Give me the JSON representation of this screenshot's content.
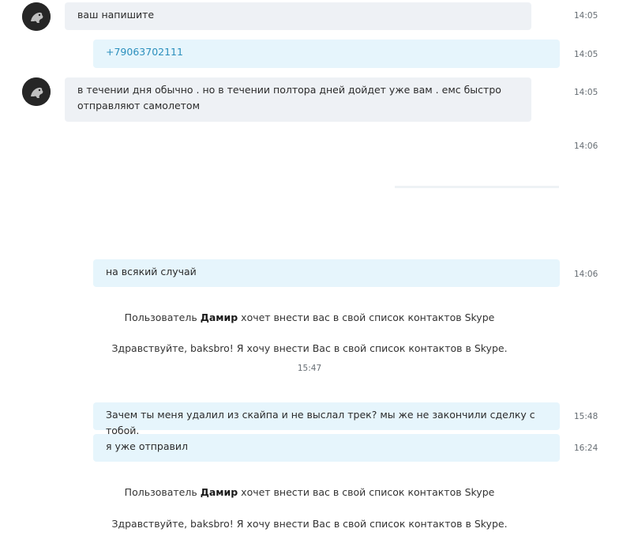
{
  "messages": [
    {
      "id": "m1",
      "direction": "in",
      "text": "ваш напишите",
      "time": "14:05"
    },
    {
      "id": "m2",
      "direction": "out",
      "text": "+79063702111",
      "time": "14:05"
    },
    {
      "id": "m3",
      "direction": "in",
      "text": "в течении дня обычно . но в течении полтора дней дойдет уже вам . емс быстро отправляют самолетом",
      "time": "14:05"
    },
    {
      "id": "m4",
      "direction": "out",
      "text": "",
      "time": "14:06"
    },
    {
      "id": "m5",
      "direction": "out",
      "text": "на всякий случай",
      "time": "14:06"
    },
    {
      "id": "m6",
      "direction": "out",
      "text": "Зачем ты меня удалил из скайпа и не выслал трек? мы же не закончили сделку с тобой.",
      "time": "15:48"
    },
    {
      "id": "m7",
      "direction": "out",
      "text": "я уже отправил",
      "time": "16:24"
    }
  ],
  "system_notices": [
    {
      "prefix": "Пользователь ",
      "user": "Дамир",
      "suffix": " хочет внести вас в свой список контактов Skype",
      "greeting": "Здравствуйте, baksbro! Я хочу внести Вас в свой список контактов в Skype.",
      "time": "15:47"
    },
    {
      "prefix": "Пользователь ",
      "user": "Дамир",
      "suffix": " хочет внести вас в свой список контактов Skype",
      "greeting": "Здравствуйте, baksbro! Я хочу внести Вас в свой список контактов в Skype."
    }
  ],
  "avatar": {
    "icon": "user-avatar-icon",
    "background": "#262626"
  },
  "colors": {
    "incoming_bubble": "#eef1f5",
    "outgoing_bubble": "#e6f5fc",
    "phone_link": "#2b8fbd",
    "timestamp": "#666d73"
  }
}
